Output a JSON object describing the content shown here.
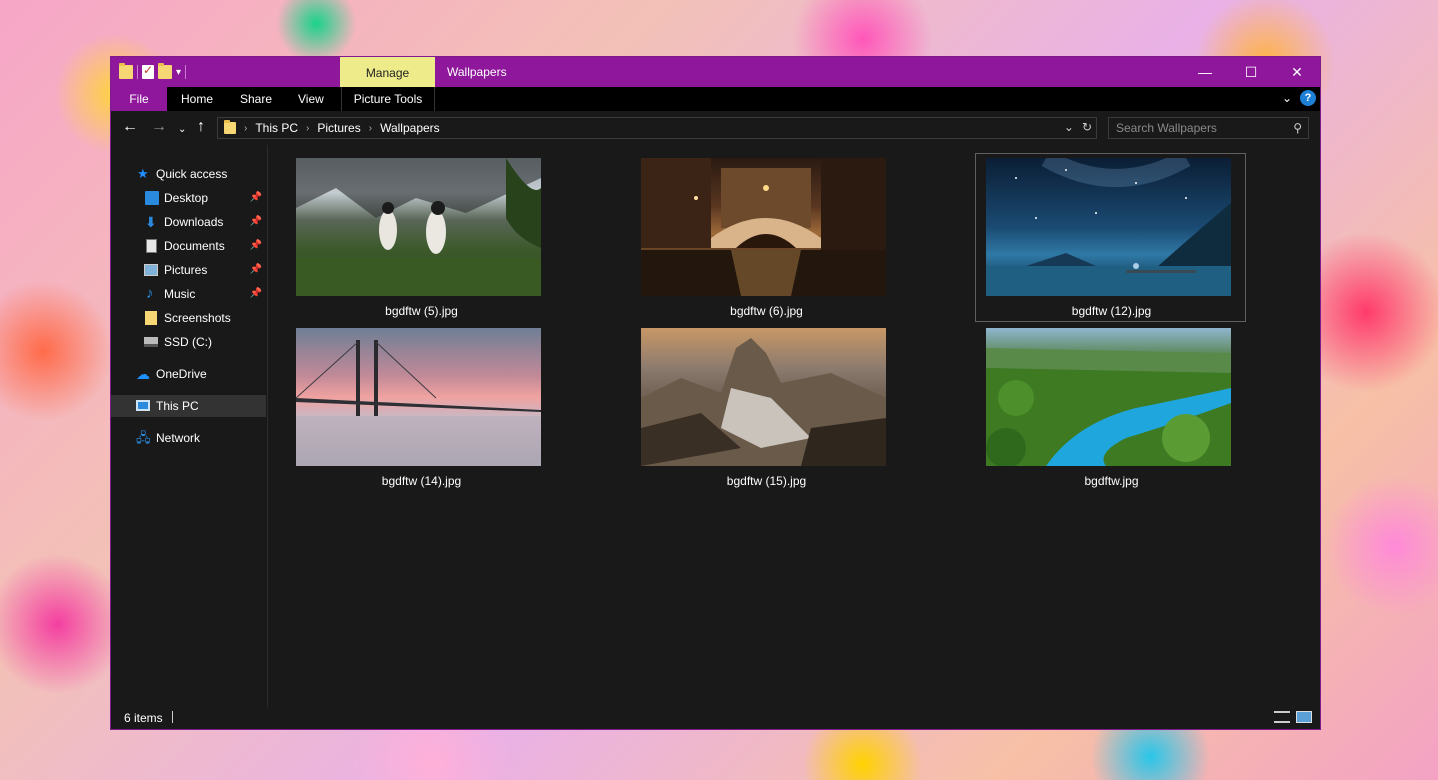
{
  "window": {
    "title": "Wallpapers",
    "manage_tab": "Manage",
    "accent_color": "#8e179b"
  },
  "caption": {
    "minimize_glyph": "—",
    "maximize_glyph": "☐",
    "close_glyph": "✕"
  },
  "ribbon": {
    "tabs": [
      "File",
      "Home",
      "Share",
      "View"
    ],
    "contextual_tab": "Picture Tools",
    "expand_glyph": "⌄",
    "help_glyph": "?"
  },
  "navigation": {
    "back_glyph": "←",
    "forward_glyph": "→",
    "recent_glyph": "⌄",
    "up_glyph": "↑"
  },
  "address": {
    "crumbs": [
      "This PC",
      "Pictures",
      "Wallpapers"
    ],
    "separator": "›",
    "dropdown_glyph": "⌄",
    "refresh_glyph": "↻"
  },
  "search": {
    "placeholder": "Search Wallpapers",
    "icon": "search-icon",
    "glyph": "⚲"
  },
  "navpane": {
    "quick_access": "Quick access",
    "items": [
      {
        "label": "Desktop",
        "icon": "desktop-icon",
        "pinned": true
      },
      {
        "label": "Downloads",
        "icon": "downloads-icon",
        "pinned": true
      },
      {
        "label": "Documents",
        "icon": "documents-icon",
        "pinned": true
      },
      {
        "label": "Pictures",
        "icon": "pictures-icon",
        "pinned": true
      },
      {
        "label": "Music",
        "icon": "music-icon",
        "pinned": true
      },
      {
        "label": "Screenshots",
        "icon": "folder-icon",
        "pinned": false
      },
      {
        "label": "SSD (C:)",
        "icon": "drive-icon",
        "pinned": false
      }
    ],
    "onedrive": "OneDrive",
    "thispc": "This PC",
    "network": "Network",
    "pin_glyph": "📌"
  },
  "files": [
    {
      "name": "bgdftw (5).jpg",
      "focused": false
    },
    {
      "name": "bgdftw (6).jpg",
      "focused": false
    },
    {
      "name": "bgdftw (12).jpg",
      "focused": true
    },
    {
      "name": "bgdftw (14).jpg",
      "focused": false
    },
    {
      "name": "bgdftw (15).jpg",
      "focused": false
    },
    {
      "name": "bgdftw.jpg",
      "focused": false
    }
  ],
  "status": {
    "item_count": "6 items"
  }
}
